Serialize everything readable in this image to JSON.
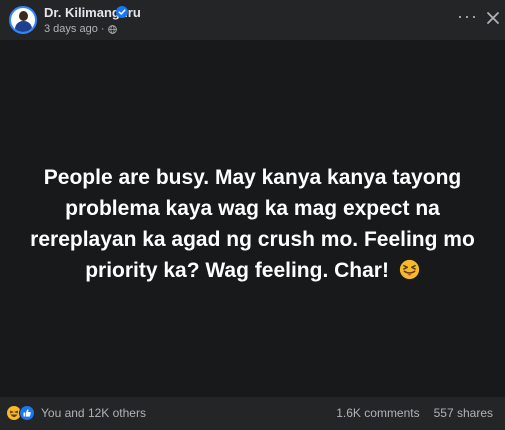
{
  "post": {
    "author": "Dr. Kilimanguru",
    "timestamp": "3 days ago",
    "separator": "·",
    "privacy_icon": "globe-icon",
    "text": "People are busy. May kanya kanya tayong problema kaya wag ka mag expect na rereplayan ka agad ng crush mo. Feeling mo priority ka? Wag feeling. Char!",
    "emoji": "squinting-face-with-tongue",
    "background_color": "#18191a"
  },
  "header": {
    "more_label": "···",
    "more_icon": "more-icon",
    "close_icon": "close-icon",
    "verified_icon": "verified-badge-icon"
  },
  "footer": {
    "reactions_icons": [
      "haha-icon",
      "like-icon"
    ],
    "reactions_label": "You and 12K others",
    "comments": "1.6K comments",
    "shares": "557 shares"
  },
  "colors": {
    "accent": "#1877f2",
    "surface": "#242526",
    "text": "#e4e6eb",
    "muted": "#b0b3b8"
  }
}
